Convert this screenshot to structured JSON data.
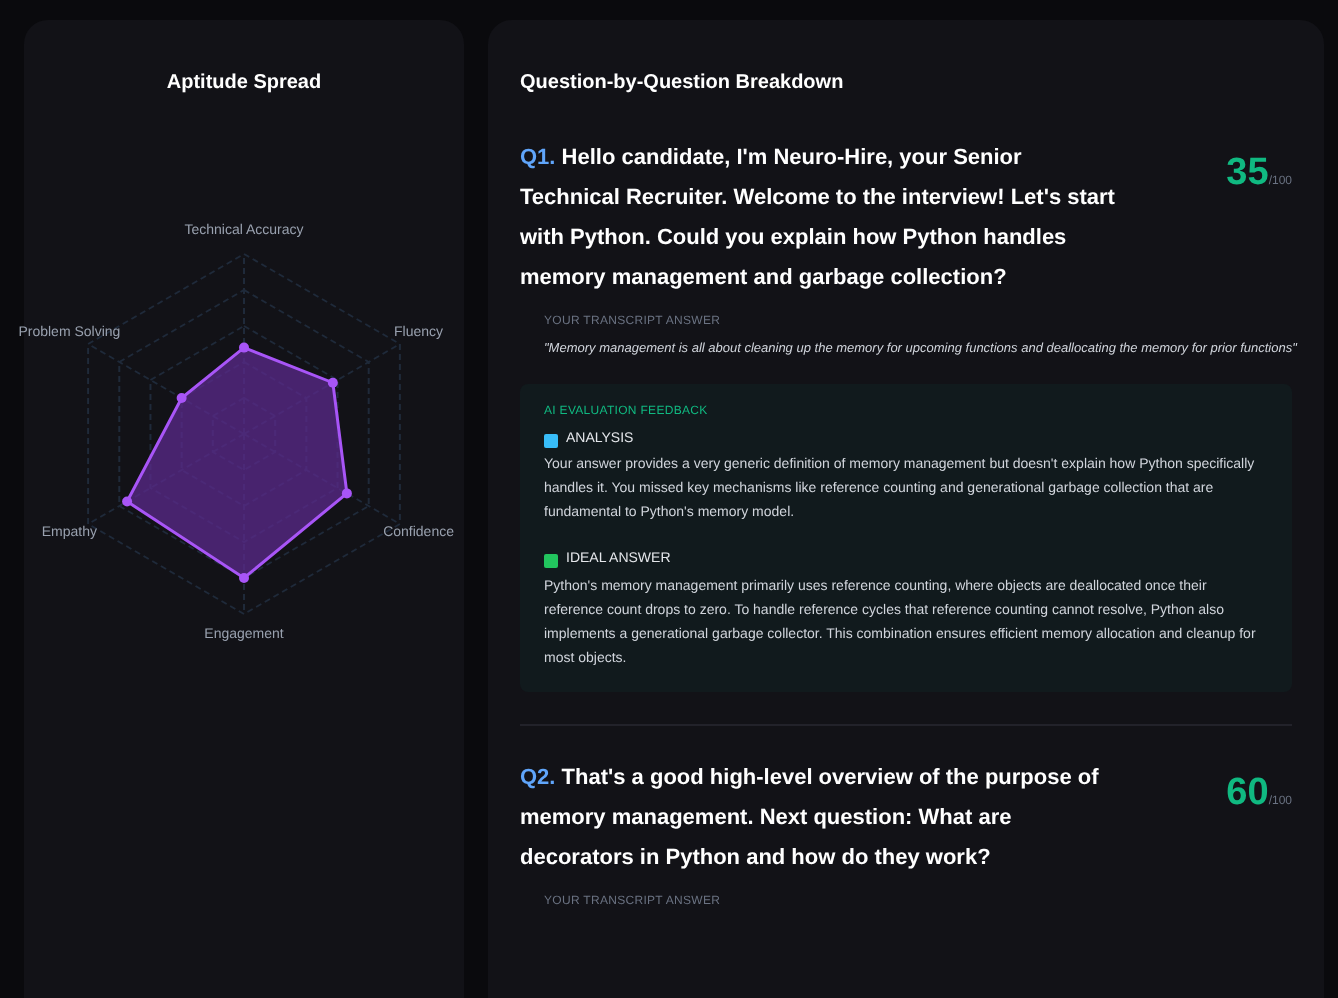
{
  "radar": {
    "title": "Aptitude Spread",
    "axes": [
      "Technical Accuracy",
      "Fluency",
      "Confidence",
      "Engagement",
      "Empathy",
      "Problem Solving"
    ]
  },
  "breakdown": {
    "title": "Question-by-Question Breakdown",
    "questions": [
      {
        "number": "Q1.",
        "text": "Hello candidate, I'm Neuro-Hire, your Senior Technical Recruiter. Welcome to the interview! Let's start with Python. Could you explain how Python handles memory management and garbage collection?",
        "score": "35",
        "score_max": "/100",
        "answer_label": "YOUR TRANSCRIPT ANSWER",
        "answer": "\"Memory management is all about cleaning up the memory for upcoming functions and deallocating the memory for prior functions\"",
        "feedback": {
          "title": "AI EVALUATION FEEDBACK",
          "sections": [
            {
              "kind": "analysis",
              "label": "ANALYSIS",
              "text": "Your answer provides a very generic definition of memory management but doesn't explain how Python specifically handles it. You missed key mechanisms like reference counting and generational garbage collection that are fundamental to Python's memory model."
            },
            {
              "kind": "ideal",
              "label": "IDEAL ANSWER",
              "text": "Python's memory management primarily uses reference counting, where objects are deallocated once their reference count drops to zero. To handle reference cycles that reference counting cannot resolve, Python also implements a generational garbage collector. This combination ensures efficient memory allocation and cleanup for most objects."
            }
          ]
        }
      },
      {
        "number": "Q2.",
        "text": "That's a good high-level overview of the purpose of memory management. Next question: What are decorators in Python and how do they work?",
        "score": "60",
        "score_max": "/100",
        "answer_label": "YOUR TRANSCRIPT ANSWER"
      }
    ]
  }
}
